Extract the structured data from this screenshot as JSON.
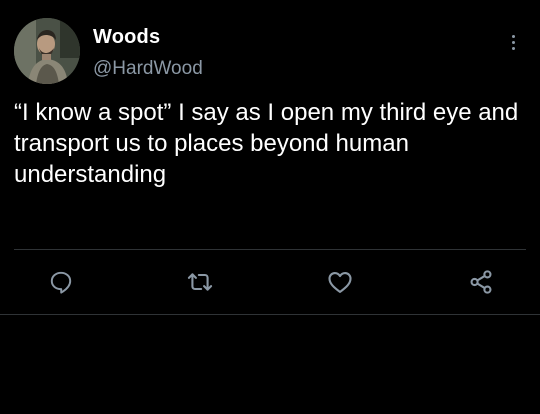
{
  "tweet": {
    "author": {
      "name": "Woods",
      "handle": "@HardWood"
    },
    "text": "“I know a spot” I say as I open my third eye and transport us to places beyond human understanding",
    "actions": {
      "reply_icon": "reply-icon",
      "retweet_icon": "retweet-icon",
      "like_icon": "heart-icon",
      "share_icon": "share-icon",
      "more_icon": "more-options-icon"
    }
  },
  "colors": {
    "background": "#000000",
    "primary_text": "#ffffff",
    "secondary_text": "#8b98a5",
    "divider": "#2f3336"
  }
}
